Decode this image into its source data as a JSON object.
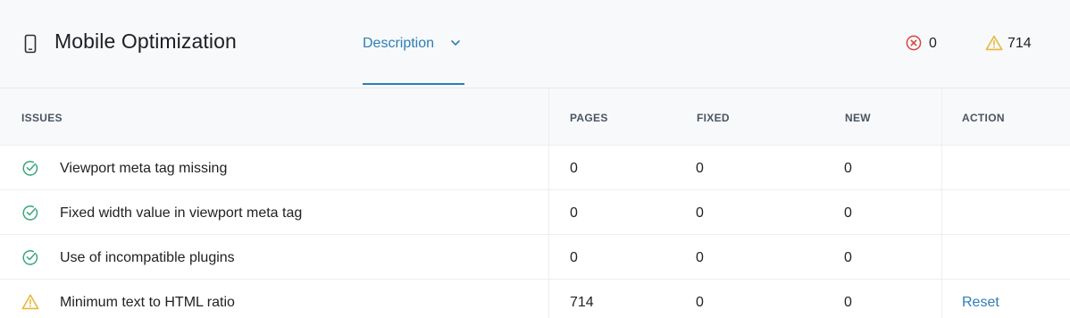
{
  "header": {
    "title": "Mobile Optimization",
    "description_tab": "Description",
    "errors_count": "0",
    "warnings_count": "714"
  },
  "table": {
    "columns": {
      "issues": "ISSUES",
      "pages": "PAGES",
      "fixed": "FIXED",
      "new": "NEW",
      "action": "ACTION"
    },
    "rows": [
      {
        "status": "passed",
        "issue": "Viewport meta tag missing",
        "pages": "0",
        "fixed": "0",
        "new": "0",
        "action": ""
      },
      {
        "status": "passed",
        "issue": "Fixed width value in viewport meta tag",
        "pages": "0",
        "fixed": "0",
        "new": "0",
        "action": ""
      },
      {
        "status": "passed",
        "issue": "Use of incompatible plugins",
        "pages": "0",
        "fixed": "0",
        "new": "0",
        "action": ""
      },
      {
        "status": "warning",
        "issue": "Minimum text to HTML ratio",
        "pages": "714",
        "fixed": "0",
        "new": "0",
        "action": "Reset"
      }
    ]
  },
  "colors": {
    "accent": "#2d7fb4",
    "passed": "#3aa57a",
    "warning": "#e8b83a",
    "error": "#d6443f"
  },
  "icons": {
    "device": "phone-icon",
    "tab_toggle": "chevron-down-icon",
    "errors": "error-circle-icon",
    "warnings": "warning-triangle-icon",
    "passed": "check-circle-icon",
    "warning": "warning-triangle-icon"
  }
}
